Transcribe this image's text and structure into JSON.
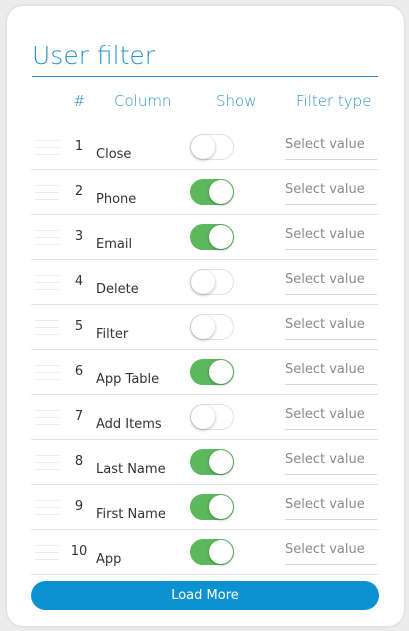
{
  "title": "User filter",
  "headers": {
    "num": "#",
    "column": "Column",
    "show": "Show",
    "filter_type": "Filter type"
  },
  "filter_placeholder": "Select value",
  "rows": [
    {
      "num": "1",
      "column": "Close",
      "show": false
    },
    {
      "num": "2",
      "column": "Phone",
      "show": true
    },
    {
      "num": "3",
      "column": "Email",
      "show": true
    },
    {
      "num": "4",
      "column": "Delete",
      "show": false
    },
    {
      "num": "5",
      "column": "Filter",
      "show": false
    },
    {
      "num": "6",
      "column": "App Table",
      "show": true
    },
    {
      "num": "7",
      "column": "Add Items",
      "show": false
    },
    {
      "num": "8",
      "column": "Last Name",
      "show": true
    },
    {
      "num": "9",
      "column": "First Name",
      "show": true
    },
    {
      "num": "10",
      "column": "App",
      "show": true
    }
  ],
  "load_more_label": "Load More",
  "colors": {
    "accent": "#2a93c9",
    "toggle_on": "#5cb85c",
    "button": "#0d92d1"
  }
}
